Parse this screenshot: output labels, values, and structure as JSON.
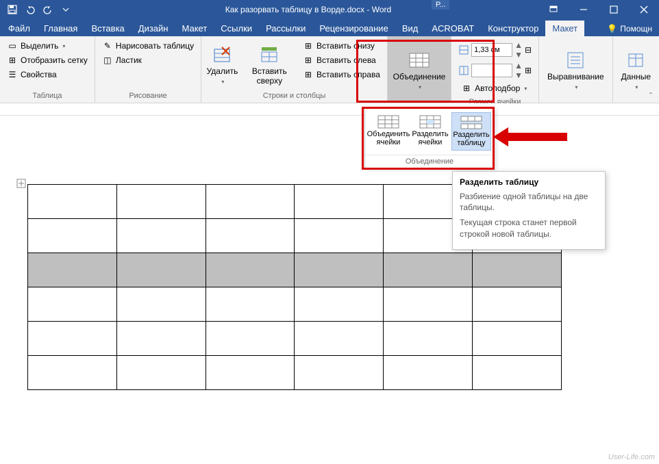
{
  "title": "Как разорвать таблицу в Ворде.docx - Word",
  "context_tab": "Р...",
  "tabs": {
    "file": "Файл",
    "home": "Главная",
    "insert": "Вставка",
    "design": "Дизайн",
    "layout1": "Макет",
    "references": "Ссылки",
    "mailings": "Рассылки",
    "review": "Рецензирование",
    "view": "Вид",
    "acrobat": "ACROBAT",
    "constructor": "Конструктор",
    "layout2": "Макет"
  },
  "help": "Помощн",
  "ribbon": {
    "table_group": {
      "select": "Выделить",
      "grid": "Отобразить сетку",
      "props": "Свойства",
      "label": "Таблица"
    },
    "draw_group": {
      "draw": "Нарисовать таблицу",
      "eraser": "Ластик",
      "label": "Рисование"
    },
    "rowscols_group": {
      "delete": "Удалить",
      "insert_above": "Вставить сверху",
      "insert_below": "Вставить снизу",
      "insert_left": "Вставить слева",
      "insert_right": "Вставить справа",
      "label": "Строки и столбцы"
    },
    "merge_group": {
      "merge": "Объединение",
      "label": ""
    },
    "cellsize_group": {
      "height": "1,33 см",
      "width": "",
      "autofit": "Автоподбор",
      "label": "Размер ячейки"
    },
    "align_group": {
      "label1": "Выравнивание",
      "label2": "Данные"
    }
  },
  "popup": {
    "merge_cells": "Объединить ячейки",
    "split_cells": "Разделить ячейки",
    "split_table": "Разделить таблицу",
    "label": "Объединение"
  },
  "tooltip": {
    "title": "Разделить таблицу",
    "line1": "Разбиение одной таблицы на две таблицы.",
    "line2": "Текущая строка станет первой строкой новой таблицы."
  },
  "watermark": "User-Life.com"
}
